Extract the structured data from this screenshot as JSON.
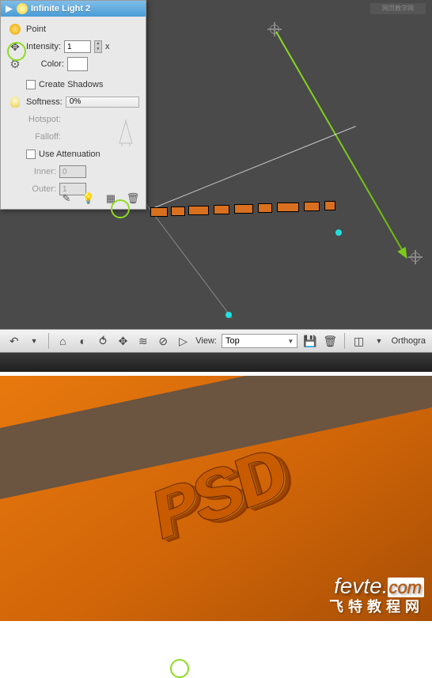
{
  "watermark_top": "网页教学网",
  "panel": {
    "title": "Infinite Light 2",
    "section": "Point",
    "intensity_label": "Intensity:",
    "intensity_value": "1",
    "intensity_suffix": "x",
    "color_label": "Color:",
    "create_shadows": "Create Shadows",
    "softness_label": "Softness:",
    "softness_value": "0%",
    "hotspot_label": "Hotspot:",
    "falloff_label": "Falloff:",
    "use_attenuation": "Use Attenuation",
    "inner_label": "Inner:",
    "inner_value": "0",
    "outer_label": "Outer:",
    "outer_value": "1"
  },
  "toolbar": {
    "view_label": "View:",
    "view_value": "Top",
    "ortho_label": "Orthogra"
  },
  "render": {
    "text": "PSD"
  },
  "footer": {
    "brand": "fevte",
    "dot": ".",
    "tld": "com",
    "subtitle": "飞特教程网"
  }
}
